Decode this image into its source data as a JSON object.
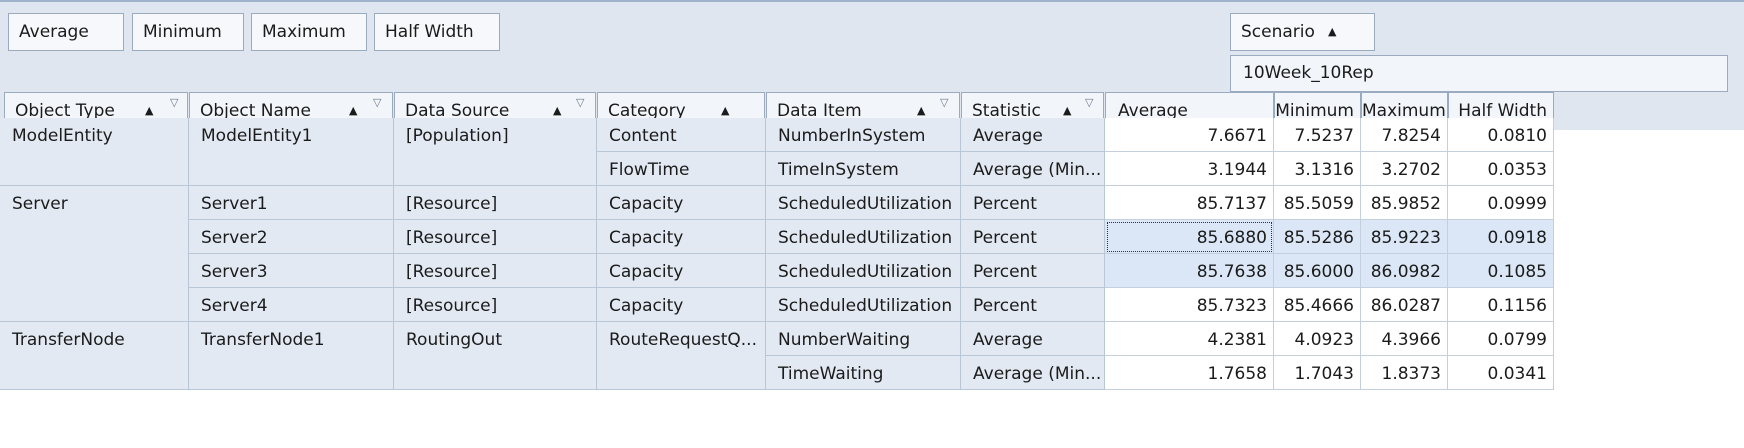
{
  "data_area": {
    "buttons": [
      {
        "label": "Average"
      },
      {
        "label": "Minimum"
      },
      {
        "label": "Maximum"
      },
      {
        "label": "Half Width"
      }
    ]
  },
  "column_area": {
    "scenario_label": "Scenario",
    "scenario_value": "10Week_10Rep"
  },
  "row_headers": [
    {
      "label": "Object Type"
    },
    {
      "label": "Object Name"
    },
    {
      "label": "Data Source"
    },
    {
      "label": "Category"
    },
    {
      "label": "Data Item"
    },
    {
      "label": "Statistic"
    }
  ],
  "stat_headers": [
    "Average",
    "Minimum",
    "Maximum",
    "Half Width"
  ],
  "object_types": [
    "ModelEntity",
    "Server",
    "TransferNode"
  ],
  "object_names": [
    "ModelEntity1",
    "Server1",
    "Server2",
    "Server3",
    "Server4",
    "TransferNode1"
  ],
  "data_sources": [
    "[Population]",
    "[Resource]",
    "[Resource]",
    "[Resource]",
    "[Resource]",
    "RoutingOut"
  ],
  "categories": [
    "Content",
    "FlowTime",
    "Capacity",
    "Capacity",
    "Capacity",
    "Capacity",
    "RouteRequestQ..."
  ],
  "data_items": [
    "NumberInSystem",
    "TimeInSystem",
    "ScheduledUtilization",
    "ScheduledUtilization",
    "ScheduledUtilization",
    "ScheduledUtilization",
    "NumberWaiting",
    "TimeWaiting"
  ],
  "statistics": [
    "Average",
    "Average (Min...",
    "Percent",
    "Percent",
    "Percent",
    "Percent",
    "Average",
    "Average (Min..."
  ],
  "values": [
    [
      "7.6671",
      "7.5237",
      "7.8254",
      "0.0810"
    ],
    [
      "3.1944",
      "3.1316",
      "3.2702",
      "0.0353"
    ],
    [
      "85.7137",
      "85.5059",
      "85.9852",
      "0.0999"
    ],
    [
      "85.6880",
      "85.5286",
      "85.9223",
      "0.0918"
    ],
    [
      "85.7638",
      "85.6000",
      "86.0982",
      "0.1085"
    ],
    [
      "85.7323",
      "85.4666",
      "86.0287",
      "0.1156"
    ],
    [
      "4.2381",
      "4.0923",
      "4.3966",
      "0.0799"
    ],
    [
      "1.7658",
      "1.7043",
      "1.8373",
      "0.0341"
    ]
  ],
  "icons": {
    "sort": "sort-ascending-icon",
    "filter": "filter-icon"
  },
  "colors": {
    "header_bg": "#dfe6ef",
    "selected_bg": "#dbe7f6",
    "border": "#9aabbf"
  }
}
